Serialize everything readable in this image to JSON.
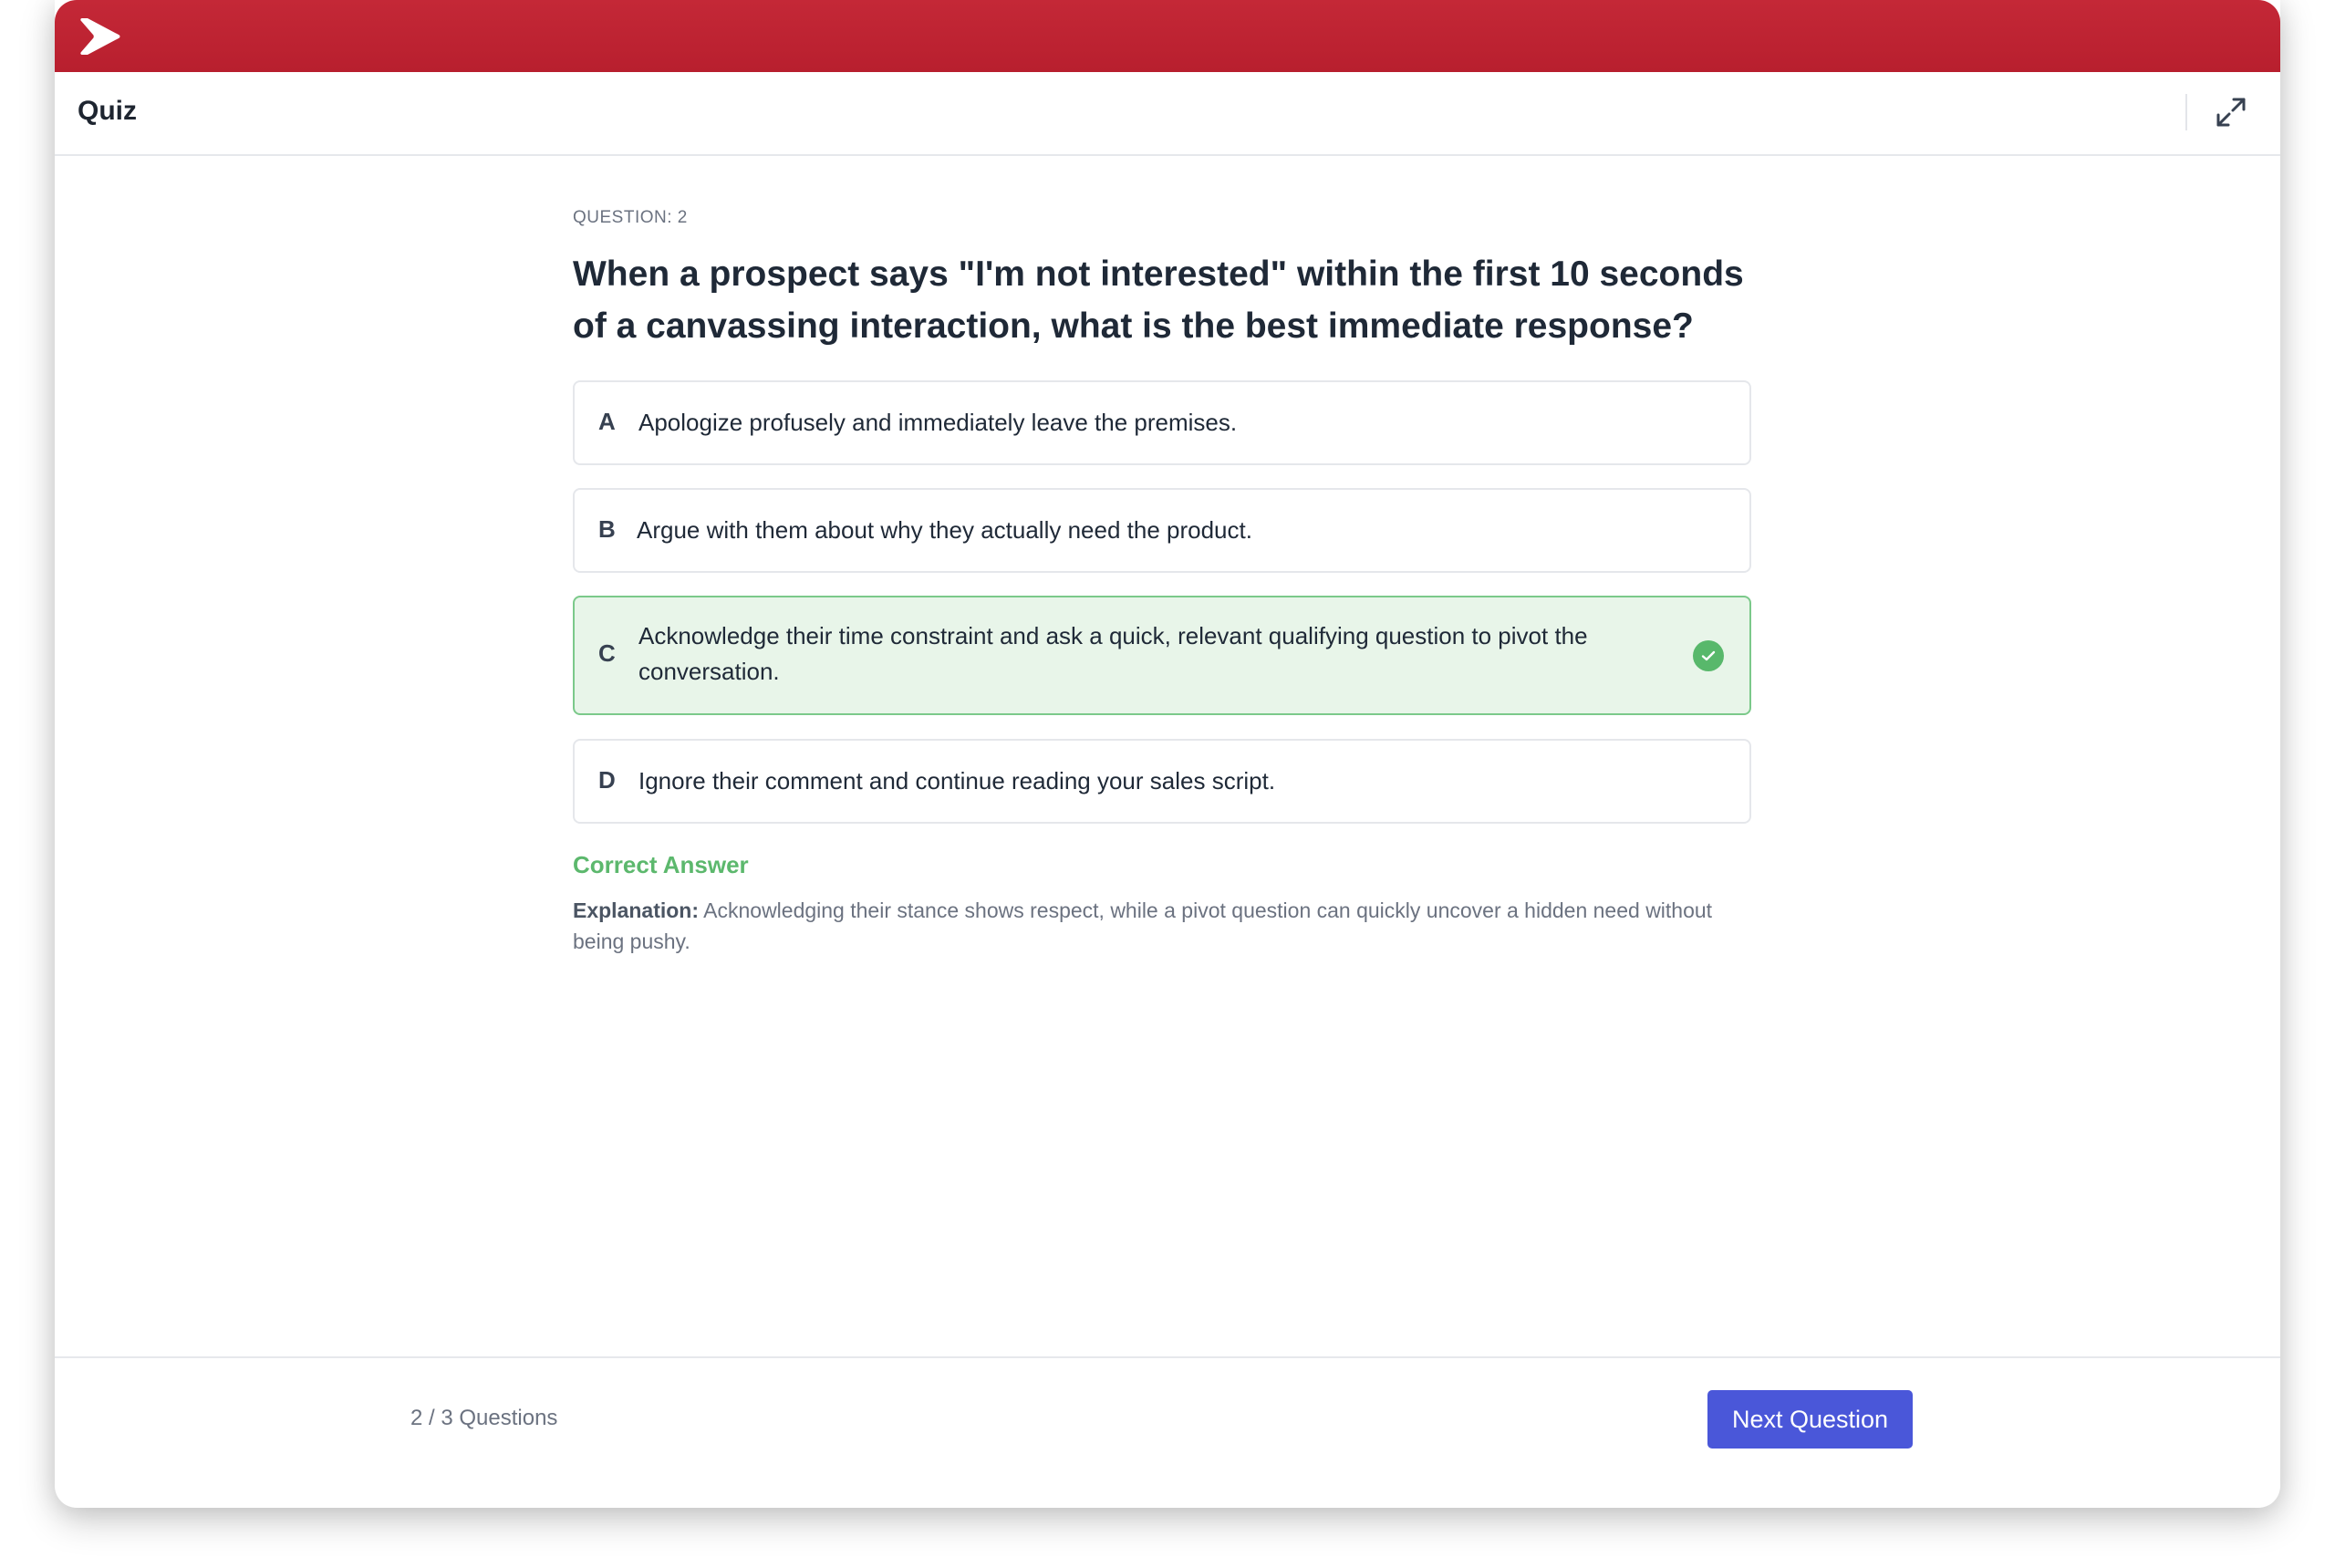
{
  "colors": {
    "brand_red": "#c42837",
    "correct_green": "#58b86b",
    "correct_bg": "#e8f5e9",
    "primary_button": "#4a57d9"
  },
  "topbar": {
    "logo_icon": "play-chevron-logo"
  },
  "header": {
    "title": "Quiz",
    "expand_icon": "expand-arrows-icon"
  },
  "question": {
    "label": "QUESTION: 2",
    "text": "When a prospect says \"I'm not interested\" within the first 10 seconds of a canvassing interaction, what is the best immediate response?"
  },
  "options": [
    {
      "letter": "A",
      "text": "Apologize profusely and immediately leave the premises.",
      "state": "default"
    },
    {
      "letter": "B",
      "text": "Argue with them about why they actually need the product.",
      "state": "default"
    },
    {
      "letter": "C",
      "text": "Acknowledge their time constraint and ask a quick, relevant qualifying question to pivot the conversation.",
      "state": "correct"
    },
    {
      "letter": "D",
      "text": "Ignore their comment and continue reading your sales script.",
      "state": "default"
    }
  ],
  "feedback": {
    "status": "Correct Answer",
    "explanation_label": "Explanation:",
    "explanation_text": "Acknowledging their stance shows respect, while a pivot question can quickly uncover a hidden need without being pushy."
  },
  "footer": {
    "progress": "2 / 3 Questions",
    "next_label": "Next Question"
  }
}
